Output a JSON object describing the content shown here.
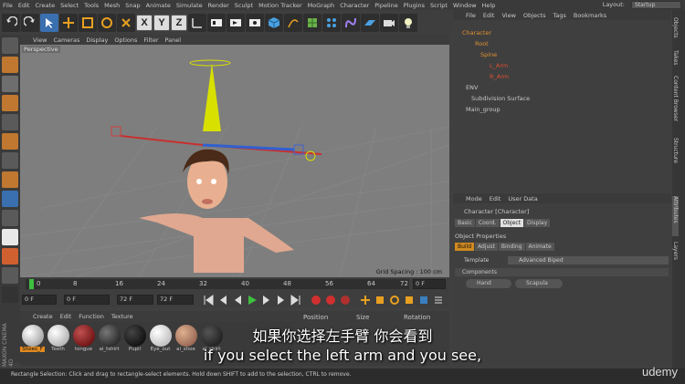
{
  "menubar": {
    "items": [
      "File",
      "Edit",
      "Create",
      "Select",
      "Tools",
      "Mesh",
      "Snap",
      "Animate",
      "Simulate",
      "Render",
      "Sculpt",
      "Motion Tracker",
      "MoGraph",
      "Character",
      "Pipeline",
      "Plugins",
      "Script",
      "Window",
      "Help"
    ],
    "layout_label": "Layout:",
    "layout_value": "Startup"
  },
  "toolbar": {
    "x": "X",
    "y": "Y",
    "z": "Z"
  },
  "viewport": {
    "menu": [
      "View",
      "Cameras",
      "Display",
      "Options",
      "Filter",
      "Panel"
    ],
    "title": "Perspective",
    "grid_spacing": "Grid Spacing : 100 cm"
  },
  "timeline": {
    "ticks": [
      "0",
      "8",
      "16",
      "24",
      "32",
      "40",
      "48",
      "56",
      "64",
      "72"
    ],
    "end_marker": "0 F",
    "start_frame": "0 F",
    "start_frame2": "0 F",
    "end_frame": "72 F",
    "end_frame2": "72 F"
  },
  "materials": {
    "menu": [
      "Create",
      "Edit",
      "Function",
      "Texture"
    ],
    "items": [
      {
        "label": "Shoes_F"
      },
      {
        "label": "Teeth"
      },
      {
        "label": "tongue"
      },
      {
        "label": "ai_tshirt"
      },
      {
        "label": "Pupil"
      },
      {
        "label": "Eye_out"
      },
      {
        "label": "ai_shoe"
      },
      {
        "label": "ai_shirt"
      }
    ]
  },
  "coords": {
    "position": "Position",
    "size": "Size",
    "rotation": "Rotation"
  },
  "object_manager": {
    "menu": [
      "File",
      "Edit",
      "View",
      "Objects",
      "Tags",
      "Bookmarks"
    ],
    "objects": [
      {
        "name": "Character"
      },
      {
        "name": "Root"
      },
      {
        "name": "Spine"
      },
      {
        "name": "L_Arm"
      },
      {
        "name": "R_Arm"
      },
      {
        "name": "ENV"
      },
      {
        "name": "Subdivision Surface"
      },
      {
        "name": "Main_group"
      }
    ]
  },
  "attributes": {
    "menu": [
      "Mode",
      "Edit",
      "User Data"
    ],
    "object_title": "Character [Character]",
    "tabs": [
      "Basic",
      "Coord.",
      "Object",
      "Display"
    ],
    "section": "Object Properties",
    "subtabs": [
      "Build",
      "Adjust",
      "Binding",
      "Animate"
    ],
    "template_label": "Template",
    "template_value": "Advanced Biped",
    "components": "Components",
    "buttons": [
      "Hand",
      "Scapula"
    ]
  },
  "side_tabs": [
    "Objects",
    "Takes",
    "Content Browser",
    "Structure",
    "Attributes",
    "Layers"
  ],
  "status": "Rectangle Selection: Click and drag to rectangle-select elements. Hold down SHIFT to add to the selection, CTRL to remove.",
  "subtitles": {
    "zh": "如果你选择左手臂 你会看到",
    "en": "if you select the left arm and you see,"
  },
  "watermark": "udemy",
  "brand": "MAXON CINEMA 4D"
}
